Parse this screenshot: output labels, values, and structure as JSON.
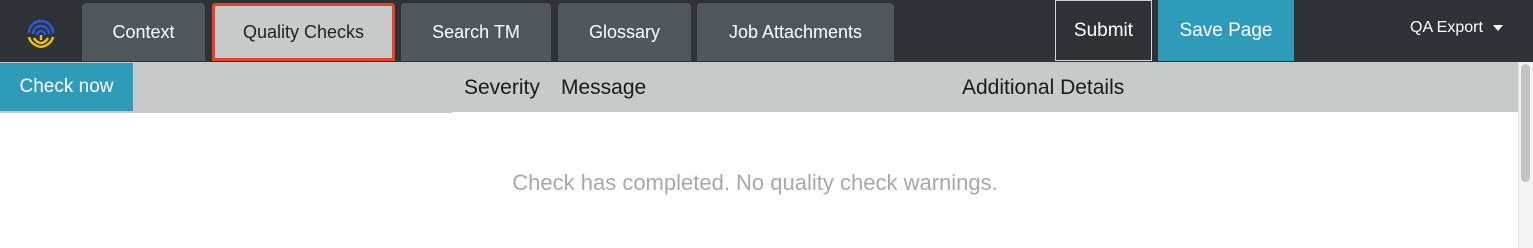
{
  "tabs": [
    {
      "label": "Context"
    },
    {
      "label": "Quality Checks",
      "active": true
    },
    {
      "label": "Search TM"
    },
    {
      "label": "Glossary"
    },
    {
      "label": "Job Attachments"
    }
  ],
  "actions": {
    "submit_label": "Submit",
    "save_label": "Save Page",
    "qa_export_label": "QA Export"
  },
  "panel": {
    "check_now_label": "Check now",
    "columns": [
      "Severity",
      "Message",
      "Additional Details"
    ],
    "empty_message": "Check has completed. No quality check warnings."
  },
  "colors": {
    "topbar": "#2f3337",
    "tab": "#50575c",
    "tab_active": "#c8cac9",
    "highlight_outline": "#e8402f",
    "accent": "#2e9bb9",
    "logo_blue": "#2a5bd7",
    "logo_yellow": "#f2c200"
  },
  "icons": {
    "logo": "fingerprint-logo-icon",
    "dropdown": "caret-down-icon"
  }
}
